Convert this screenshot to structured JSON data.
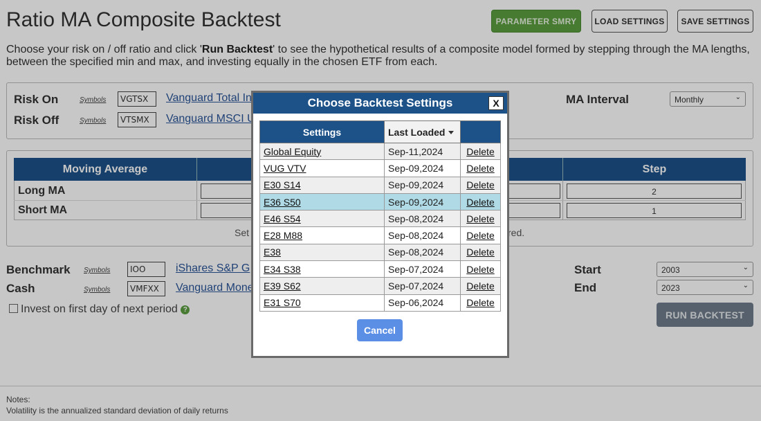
{
  "page": {
    "title": "Ratio MA Composite Backtest",
    "intro_a": "Choose your risk on / off ratio and click '",
    "intro_b": "Run Backtest",
    "intro_c": "' to see the hypothetical results of a composite model formed by stepping through the MA lengths, between the specified min and max, and investing equally in the chosen ETF from each."
  },
  "header": {
    "parameter_summary": "PARAMETER SMRY",
    "load_settings": "LOAD SETTINGS",
    "save_settings": "SAVE SETTINGS"
  },
  "risk": {
    "on_label": "Risk On",
    "off_label": "Risk Off",
    "symbols_label": "Symbols",
    "on_symbol": "VGTSX",
    "off_symbol": "VTSMX",
    "on_fund": "Vanguard Total In",
    "off_fund": "Vanguard MSCI U",
    "ma_interval_label": "MA Interval",
    "ma_interval_value": "Monthly"
  },
  "ma_table": {
    "col_moving_average": "Moving Average",
    "col_step": "Step",
    "long_label": "Long MA",
    "short_label": "Short MA",
    "long_step": "2",
    "short_step": "1",
    "note_left": "Set",
    "note_right": "red."
  },
  "bottom": {
    "benchmark_label": "Benchmark",
    "cash_label": "Cash",
    "symbols_label": "Symbols",
    "benchmark_symbol": "IOO",
    "cash_symbol": "VMFXX",
    "benchmark_fund": "iShares S&P G",
    "cash_fund": "Vanguard Mone",
    "invest_first_day": "Invest on first day of next period",
    "help": "?",
    "start_label": "Start",
    "end_label": "End",
    "start_value": "2003",
    "end_value": "2023",
    "run_backtest": "RUN BACKTEST"
  },
  "notes": {
    "heading": "Notes:",
    "line1": "Volatility is the annualized standard deviation of daily returns"
  },
  "modal": {
    "title": "Choose Backtest Settings",
    "close": "X",
    "col_settings": "Settings",
    "col_last_loaded": "Last Loaded",
    "cancel": "Cancel",
    "rows": [
      {
        "name": "Global Equity",
        "date": "Sep-11,2024",
        "action": "Delete"
      },
      {
        "name": "VUG VTV",
        "date": "Sep-09,2024",
        "action": "Delete"
      },
      {
        "name": "E30 S14",
        "date": "Sep-09,2024",
        "action": "Delete"
      },
      {
        "name": "E36 S50",
        "date": "Sep-09,2024",
        "action": "Delete"
      },
      {
        "name": "E46 S54",
        "date": "Sep-08,2024",
        "action": "Delete"
      },
      {
        "name": "E28 M88",
        "date": "Sep-08,2024",
        "action": "Delete"
      },
      {
        "name": "E38",
        "date": "Sep-08,2024",
        "action": "Delete"
      },
      {
        "name": "E34 S38",
        "date": "Sep-07,2024",
        "action": "Delete"
      },
      {
        "name": "E39 S62",
        "date": "Sep-07,2024",
        "action": "Delete"
      },
      {
        "name": "E31 S70",
        "date": "Sep-06,2024",
        "action": "Delete"
      }
    ],
    "selected_row": "E36 S50"
  },
  "colors": {
    "header_blue": "#1d5289",
    "selected_row": "#b0dbe6",
    "cancel_blue": "#5b8fe6",
    "param_green": "#5a9e3f"
  },
  "icons": {
    "close": "close-icon",
    "sort": "sort-caret-icon",
    "help": "help-icon",
    "chevron": "chevron-down-icon"
  }
}
